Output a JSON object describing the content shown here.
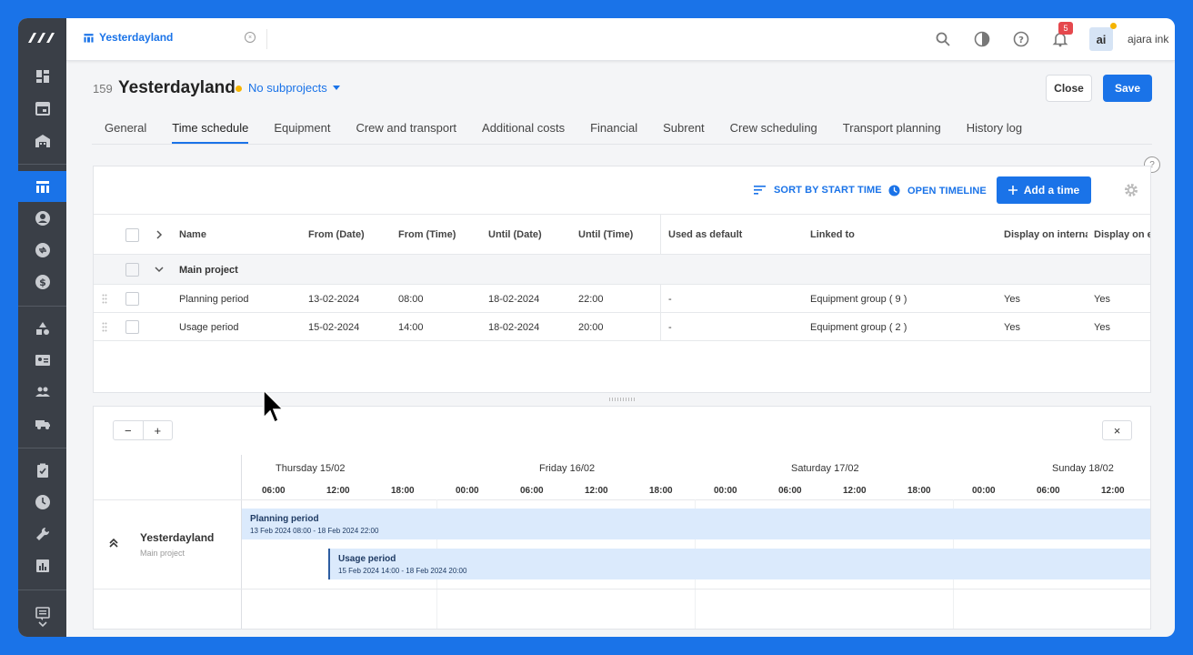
{
  "top": {
    "tab_title": "Yesterdayland",
    "tab_close": "×",
    "badge_count": "5",
    "avatar_initials": "ai",
    "user_name": "ajara ink"
  },
  "header": {
    "project_number": "159",
    "project_title": "Yesterdayland",
    "subprojects_label": "No subprojects",
    "close_label": "Close",
    "save_label": "Save"
  },
  "tabs": [
    {
      "label": "General"
    },
    {
      "label": "Time schedule"
    },
    {
      "label": "Equipment"
    },
    {
      "label": "Crew and transport"
    },
    {
      "label": "Additional costs"
    },
    {
      "label": "Financial"
    },
    {
      "label": "Subrent"
    },
    {
      "label": "Crew scheduling"
    },
    {
      "label": "Transport planning"
    },
    {
      "label": "History log"
    }
  ],
  "toolbar": {
    "sort_label": "SORT BY START TIME",
    "timeline_label": "OPEN TIMELINE",
    "add_label": "Add a time",
    "help": "?"
  },
  "table": {
    "columns": [
      "Name",
      "From (Date)",
      "From (Time)",
      "Until (Date)",
      "Until (Time)",
      "Used as default",
      "Linked to",
      "Display on interna",
      "Display on ex"
    ],
    "group_label": "Main project",
    "rows": [
      {
        "name": "Planning period",
        "from_date": "13-02-2024",
        "from_time": "08:00",
        "until_date": "18-02-2024",
        "until_time": "22:00",
        "default": "-",
        "linked": "Equipment group ( 9 )",
        "internal": "Yes",
        "external": "Yes"
      },
      {
        "name": "Usage period",
        "from_date": "15-02-2024",
        "from_time": "14:00",
        "until_date": "18-02-2024",
        "until_time": "20:00",
        "default": "-",
        "linked": "Equipment group ( 2 )",
        "internal": "Yes",
        "external": "Yes"
      }
    ]
  },
  "timeline": {
    "zoom_out": "−",
    "zoom_in": "+",
    "close": "×",
    "days": [
      "Thursday 15/02",
      "Friday 16/02",
      "Saturday 17/02",
      "Sunday 18/02"
    ],
    "hours": [
      "06:00",
      "12:00",
      "18:00",
      "00:00",
      "06:00",
      "12:00",
      "18:00",
      "00:00",
      "06:00",
      "12:00",
      "18:00",
      "00:00",
      "06:00",
      "12:00"
    ],
    "resource_name": "Yesterdayland",
    "resource_sub": "Main project",
    "bars": [
      {
        "title": "Planning period",
        "sub": "13 Feb 2024 08:00 - 18 Feb 2024 22:00"
      },
      {
        "title": "Usage period",
        "sub": "15 Feb 2024 14:00 - 18 Feb 2024 20:00"
      }
    ]
  },
  "colors": {
    "accent": "#1a73e8",
    "sidebar": "#3a3f47",
    "bar_fill": "#dbeafc"
  }
}
